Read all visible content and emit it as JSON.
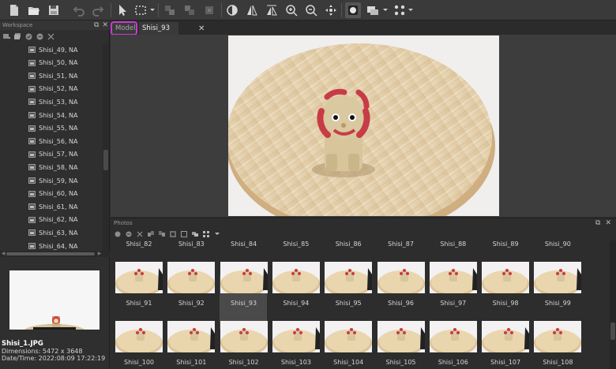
{
  "toolbar": {
    "icons": [
      "new-file-icon",
      "open-folder-icon",
      "save-icon",
      "undo-icon",
      "redo-icon",
      "pointer-icon",
      "rect-select-icon",
      "align-icon",
      "align-icon",
      "align-icon",
      "mask-icon",
      "flip-icon",
      "flip-icon",
      "zoom-in-icon",
      "zoom-out-icon",
      "pan-icon",
      "record-icon",
      "view-icon",
      "grid-dots-icon"
    ]
  },
  "workspace": {
    "title": "Workspace",
    "items": [
      "Shisi_49, NA",
      "Shisi_50, NA",
      "Shisi_51, NA",
      "Shisi_52, NA",
      "Shisi_53, NA",
      "Shisi_54, NA",
      "Shisi_55, NA",
      "Shisi_56, NA",
      "Shisi_57, NA",
      "Shisi_58, NA",
      "Shisi_59, NA",
      "Shisi_60, NA",
      "Shisi_61, NA",
      "Shisi_62, NA",
      "Shisi_63, NA",
      "Shisi_64, NA"
    ],
    "file": {
      "name": "Shisi_1.JPG",
      "dimensions": "Dimensions: 5472 x 3648",
      "datetime": "Date/Time: 2022:08:09 17:22:19"
    }
  },
  "tabs": {
    "model": "Model",
    "active": "Shisi_93",
    "close": "✕"
  },
  "photos": {
    "title": "Photos",
    "top_labels": [
      "Shisi_82",
      "Shisi_83",
      "Shisi_84",
      "Shisi_85",
      "Shisi_86",
      "Shisi_87",
      "Shisi_88",
      "Shisi_89",
      "Shisi_90"
    ],
    "row1": [
      "Shisi_91",
      "Shisi_92",
      "Shisi_93",
      "Shisi_94",
      "Shisi_95",
      "Shisi_96",
      "Shisi_97",
      "Shisi_98",
      "Shisi_99"
    ],
    "row2": [
      "Shisi_100",
      "Shisi_101",
      "Shisi_102",
      "Shisi_103",
      "Shisi_104",
      "Shisi_105",
      "Shisi_106",
      "Shisi_107",
      "Shisi_108"
    ],
    "selected": "Shisi_93"
  },
  "colors": {
    "highlight": "#c63bd3",
    "panel": "#2f2f2f",
    "toolbar": "#3a3a3a"
  }
}
